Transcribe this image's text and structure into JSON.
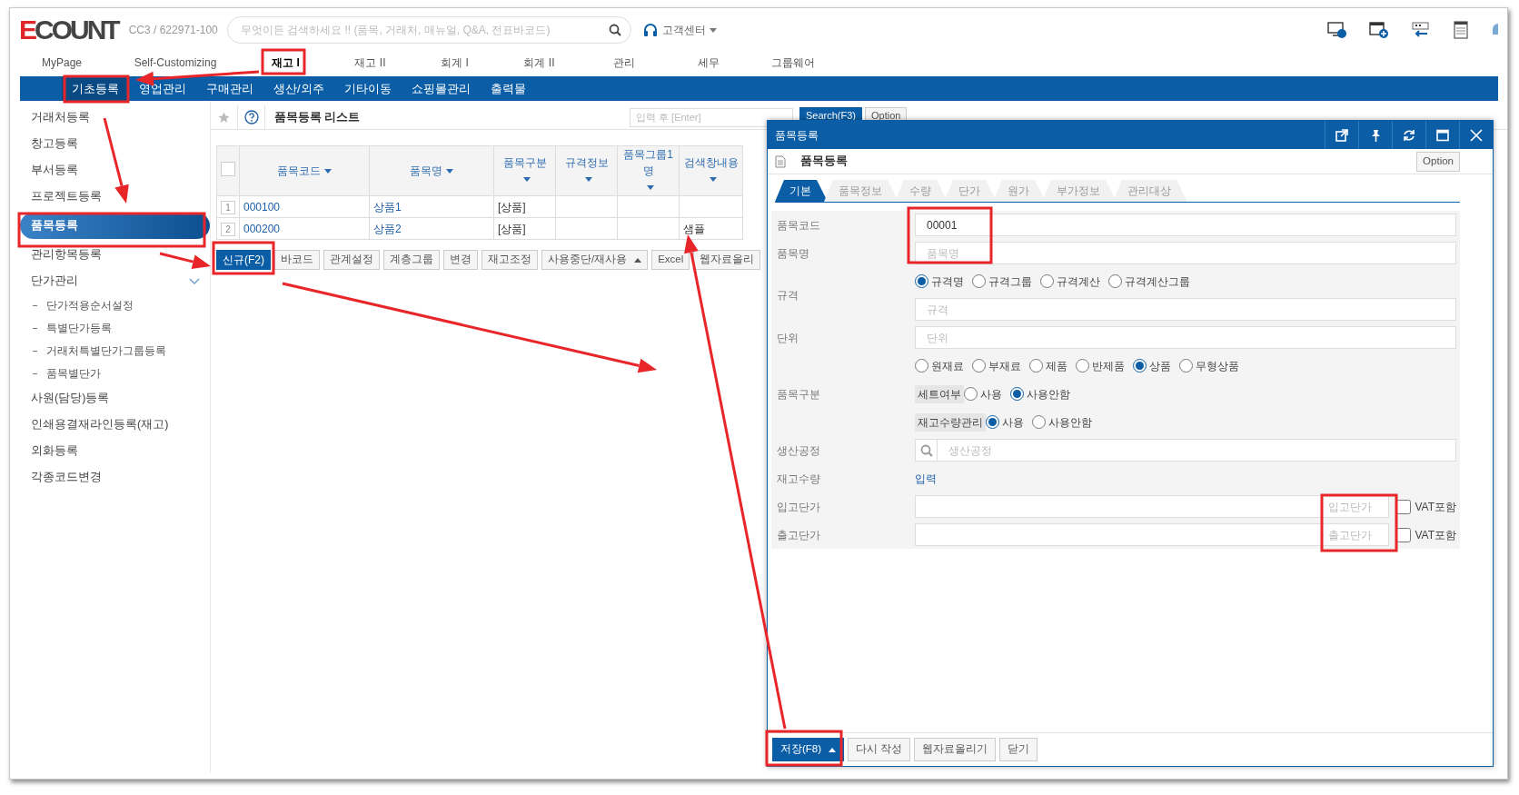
{
  "header": {
    "logo": "ECOUNT",
    "account": "CC3 / 622971-100",
    "search_placeholder": "무엇이든 검색하세요 !! (품목, 거래처, 매뉴얼, Q&A, 전표바코드)",
    "support": "고객센터"
  },
  "main_menu": [
    {
      "label": "MyPage",
      "selected": false
    },
    {
      "label": "Self-Customizing",
      "selected": false
    },
    {
      "label": "재고 I",
      "selected": true
    },
    {
      "label": "재고 II",
      "selected": false
    },
    {
      "label": "회계 I",
      "selected": false
    },
    {
      "label": "회계 II",
      "selected": false
    },
    {
      "label": "관리",
      "selected": false
    },
    {
      "label": "세무",
      "selected": false
    },
    {
      "label": "그룹웨어",
      "selected": false
    }
  ],
  "sub_menu": [
    {
      "label": "기초등록",
      "selected": true
    },
    {
      "label": "영업관리",
      "selected": false
    },
    {
      "label": "구매관리",
      "selected": false
    },
    {
      "label": "생산/외주",
      "selected": false
    },
    {
      "label": "기타이동",
      "selected": false
    },
    {
      "label": "쇼핑몰관리",
      "selected": false
    },
    {
      "label": "출력물",
      "selected": false
    }
  ],
  "sidebar": {
    "items": [
      {
        "label": "거래처등록",
        "selected": false
      },
      {
        "label": "창고등록",
        "selected": false
      },
      {
        "label": "부서등록",
        "selected": false
      },
      {
        "label": "프로젝트등록",
        "selected": false
      },
      {
        "label": "품목등록",
        "selected": true
      },
      {
        "label": "관리항목등록",
        "selected": false
      },
      {
        "label": "단가관리",
        "selected": false,
        "expanded": true,
        "children": [
          {
            "label": "단가적용순서설정",
            "selected": false
          },
          {
            "label": "특별단가등록",
            "selected": false
          },
          {
            "label": "거래처특별단가그룹등록",
            "selected": false
          },
          {
            "label": "품목별단가",
            "selected": false
          }
        ]
      },
      {
        "label": "사원(담당)등록",
        "selected": false
      },
      {
        "label": "인쇄용결재라인등록(재고)",
        "selected": false
      },
      {
        "label": "외화등록",
        "selected": false
      },
      {
        "label": "각종코드변경",
        "selected": false
      }
    ]
  },
  "list": {
    "title": "품목등록 리스트",
    "search_placeholder": "입력 후 [Enter]",
    "search_button": "Search(F3)",
    "option_button": "Option",
    "table": {
      "all_selected": false,
      "columns": [
        "품목코드",
        "품목명",
        "품목구분",
        "규격정보",
        "품목그룹1명",
        "검색창내용"
      ],
      "rows": [
        {
          "number": "1",
          "cells": [
            "000100",
            "상품1",
            "[상품]",
            null,
            null,
            null
          ]
        },
        {
          "number": "2",
          "cells": [
            "000200",
            "상품2",
            "[상품]",
            null,
            null,
            "샘플"
          ]
        }
      ]
    },
    "buttons": [
      {
        "label": "신규(F2)",
        "kind": "primary"
      },
      {
        "label": "바코드",
        "kind": "default"
      },
      {
        "label": "관계설정",
        "kind": "default"
      },
      {
        "label": "계층그룹",
        "kind": "default"
      },
      {
        "label": "변경",
        "kind": "default"
      },
      {
        "label": "재고조정",
        "kind": "default"
      },
      {
        "label": "사용중단/재사용",
        "kind": "dropdown"
      },
      {
        "label": "Excel",
        "kind": "default"
      },
      {
        "label": "웹자료올리",
        "kind": "default"
      }
    ]
  },
  "dialog": {
    "title": "품목등록",
    "heading": "품목등록",
    "option_button": "Option",
    "tabs": [
      {
        "label": "기본",
        "selected": true
      },
      {
        "label": "품목정보",
        "selected": false
      },
      {
        "label": "수량",
        "selected": false
      },
      {
        "label": "단가",
        "selected": false
      },
      {
        "label": "원가",
        "selected": false
      },
      {
        "label": "부가정보",
        "selected": false
      },
      {
        "label": "관리대상",
        "selected": false
      }
    ],
    "form": [
      {
        "label": "품목코드",
        "kind": "input",
        "value": "00001"
      },
      {
        "label": "품목명",
        "kind": "input",
        "placeholder": "품목명"
      },
      {
        "label": "규격",
        "kind": "radio_input",
        "options": [
          {
            "label": "규격명",
            "selected": true
          },
          {
            "label": "규격그룹",
            "selected": false
          },
          {
            "label": "규격계산",
            "selected": false
          },
          {
            "label": "규격계산그룹",
            "selected": false
          }
        ],
        "placeholder": "규격"
      },
      {
        "label": "단위",
        "kind": "input",
        "placeholder": "단위"
      },
      {
        "label": "품목구분",
        "kind": "radio_groups",
        "groups": [
          {
            "options": [
              {
                "label": "원재료",
                "selected": false
              },
              {
                "label": "부재료",
                "selected": false
              },
              {
                "label": "제품",
                "selected": false
              },
              {
                "label": "반제품",
                "selected": false
              },
              {
                "label": "상품",
                "selected": true
              },
              {
                "label": "무형상품",
                "selected": false
              }
            ]
          },
          {
            "title": "세트여부",
            "options": [
              {
                "label": "사용",
                "selected": false
              },
              {
                "label": "사용안함",
                "selected": true
              }
            ]
          },
          {
            "title": "재고수량관리",
            "options": [
              {
                "label": "사용",
                "selected": true
              },
              {
                "label": "사용안함",
                "selected": false
              }
            ]
          }
        ]
      },
      {
        "label": "생산공정",
        "kind": "search",
        "placeholder": "생산공정"
      },
      {
        "label": "재고수량",
        "kind": "link",
        "link": "입력"
      },
      {
        "label": "입고단가",
        "kind": "price",
        "placeholder": "입고단가",
        "checkbox": {
          "label": "VAT포함",
          "checked": false
        }
      },
      {
        "label": "출고단가",
        "kind": "price",
        "placeholder": "출고단가",
        "checkbox": {
          "label": "VAT포함",
          "checked": false
        }
      }
    ],
    "footer_buttons": [
      {
        "label": "저장(F8)",
        "kind": "primary_dropdown"
      },
      {
        "label": "다시 작성",
        "kind": "default"
      },
      {
        "label": "웹자료올리기",
        "kind": "default"
      },
      {
        "label": "닫기",
        "kind": "default"
      }
    ]
  }
}
